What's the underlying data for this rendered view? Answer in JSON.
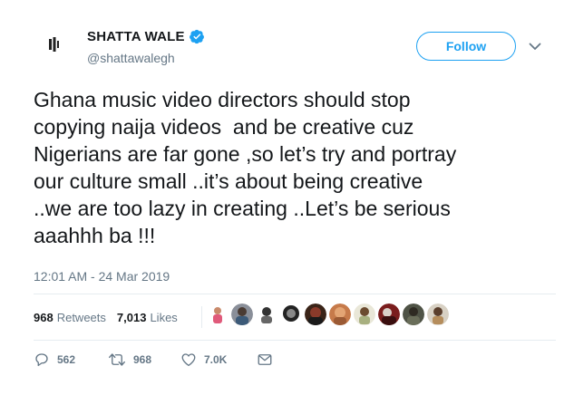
{
  "user": {
    "display_name": "SHATTA WALE",
    "handle": "@shattawalegh",
    "verified": true,
    "avatar_icon": "waveform-bars-icon"
  },
  "follow_label": "Follow",
  "tweet": {
    "lines": [
      "Ghana music video directors should stop",
      "copying naija videos  and be creative cuz",
      "Nigerians are far gone ,so let’s try and portray",
      "our culture small ..it’s about being creative",
      "..we are too lazy in creating ..Let’s be serious",
      "aaahhh ba !!!"
    ],
    "timestamp": "12:01 AM - 24 Mar 2019"
  },
  "stats": {
    "retweets_count": "968",
    "retweets_label": "Retweets",
    "likes_count": "7,013",
    "likes_label": "Likes",
    "liker_avatar_count": 10
  },
  "actions": {
    "reply_count": "562",
    "retweet_count": "968",
    "like_count": "7.0K"
  },
  "colors": {
    "accent": "#1da1f2",
    "muted": "#657786",
    "text": "#14171a",
    "divider": "#e6ecf0"
  }
}
